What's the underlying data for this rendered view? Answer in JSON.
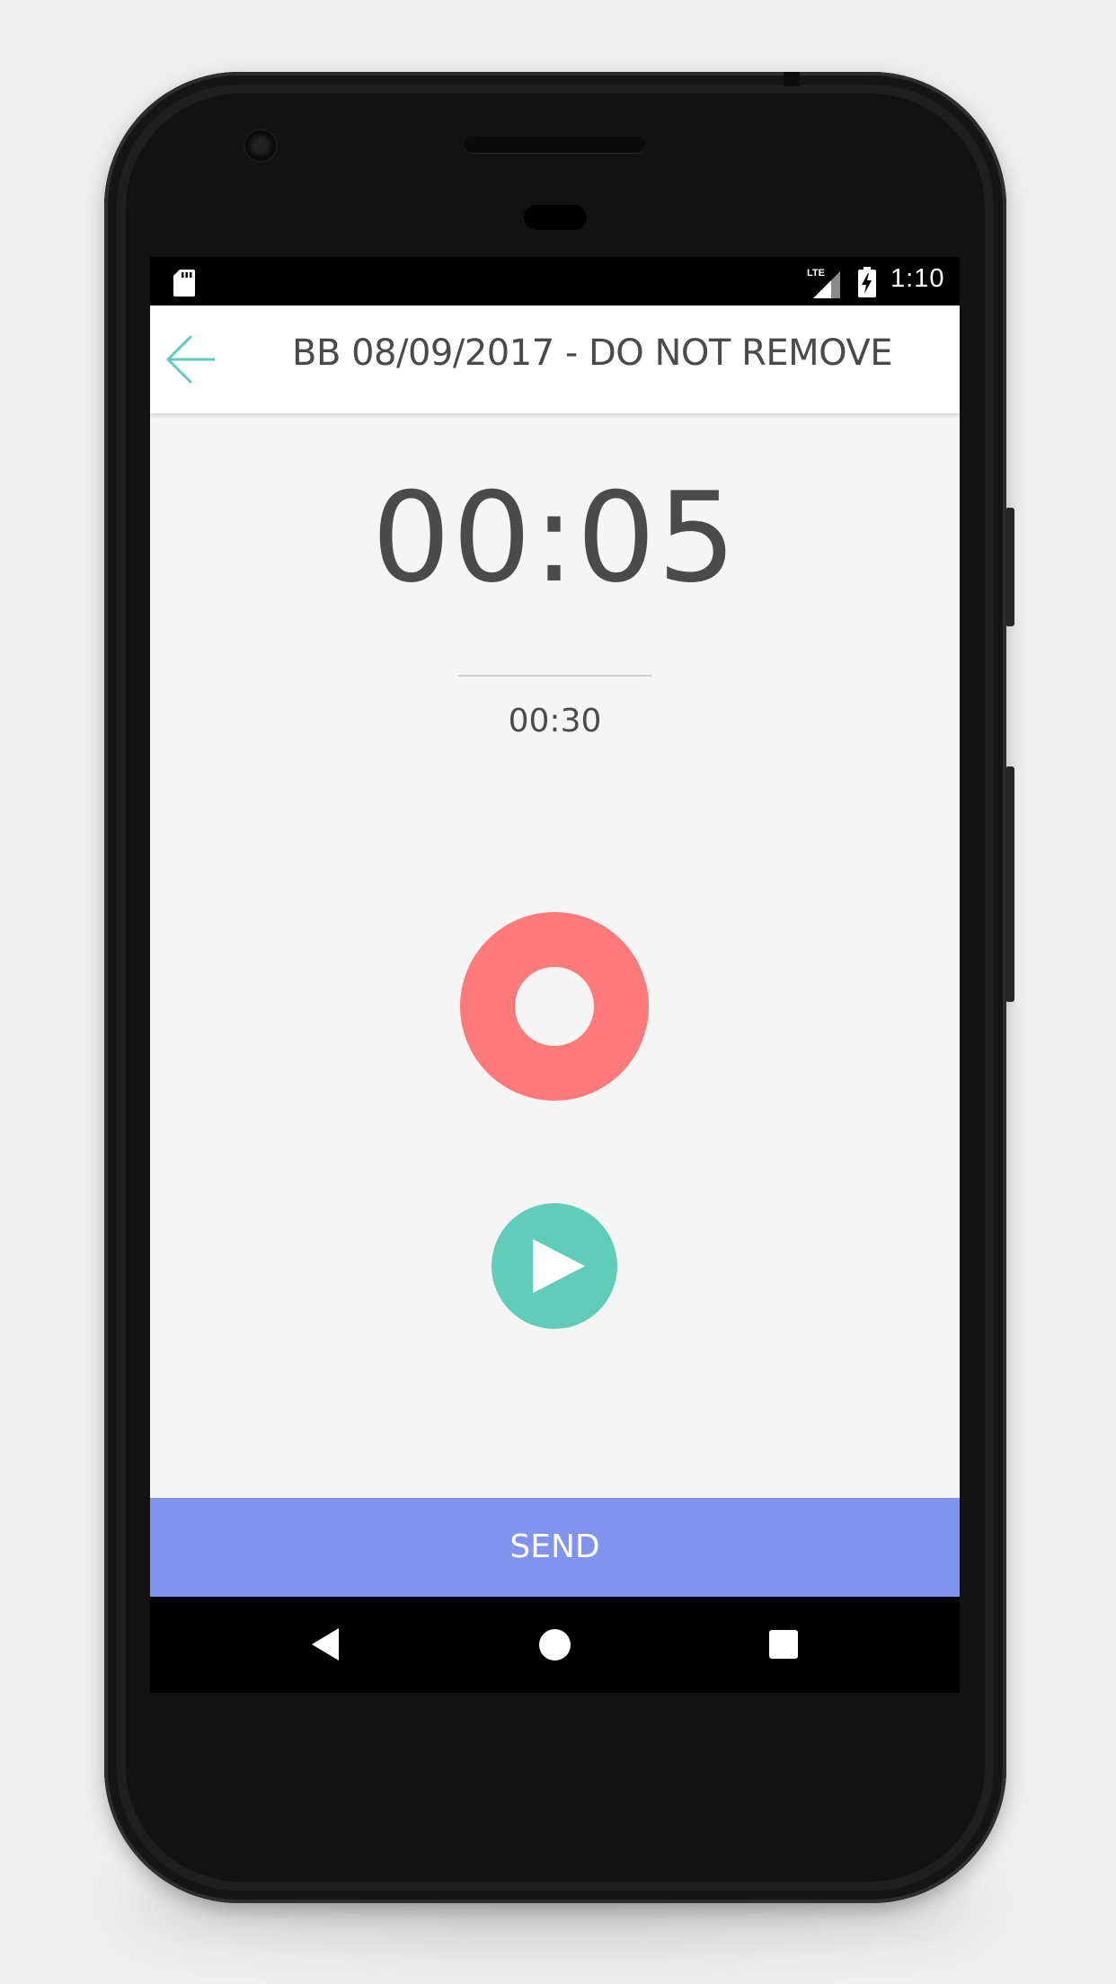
{
  "status_bar": {
    "time": "1:10",
    "network": "LTE",
    "icons": [
      "sd-card-icon",
      "lte-signal-icon",
      "battery-charging-icon"
    ]
  },
  "header": {
    "back_icon": "arrow-left-icon",
    "title": "BB 08/09/2017 - DO NOT REMOVE"
  },
  "recorder": {
    "elapsed": "00:05",
    "max": "00:30",
    "record_icon": "record-icon",
    "play_icon": "play-icon"
  },
  "send": {
    "label": "SEND"
  },
  "nav": {
    "icons": [
      "nav-back-icon",
      "nav-home-icon",
      "nav-recents-icon"
    ]
  },
  "colors": {
    "accent_teal": "#5fcdb8",
    "record_red": "#ff7b7b",
    "send_blue": "#8093ef",
    "text_dark": "#4b4b4b",
    "app_background": "#f5f5f5"
  }
}
